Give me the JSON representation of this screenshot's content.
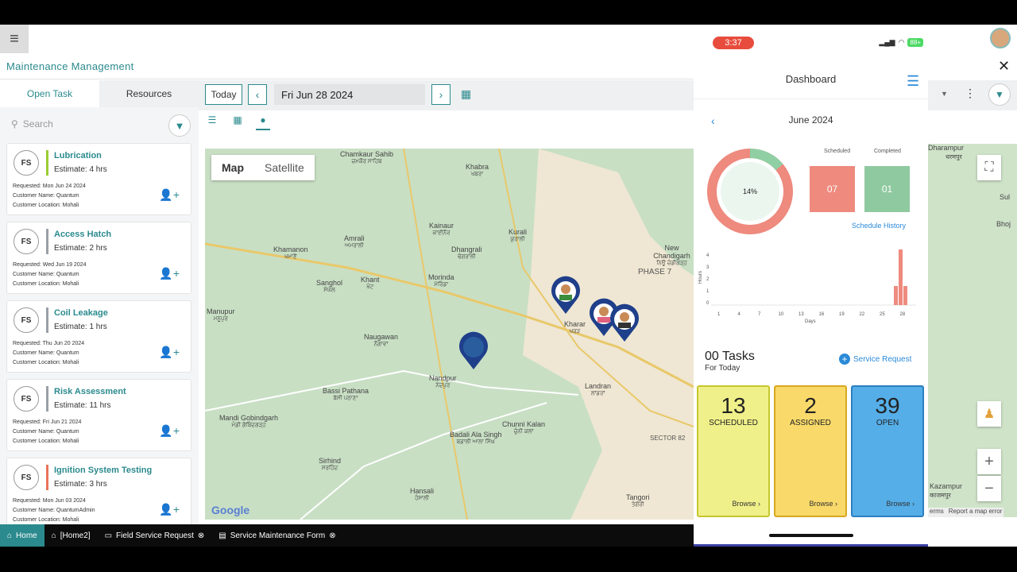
{
  "app": {
    "title": "Maintenance Management",
    "tabs": [
      "Open Task",
      "Resources"
    ],
    "search_placeholder": "Search"
  },
  "toolbar": {
    "today": "Today",
    "date": "Fri Jun 28 2024"
  },
  "map": {
    "type_map": "Map",
    "type_satellite": "Satellite",
    "google_logo": "Google",
    "places": [
      {
        "name": "Chamkaur Sahib",
        "sub": "ਚਮਕੌਰ ਸਾਹਿਬ"
      },
      {
        "name": "Khabra",
        "sub": "ਖਬਰਾ"
      },
      {
        "name": "Kainaur",
        "sub": "ਕਾਈਨੌਰ"
      },
      {
        "name": "Kurali",
        "sub": "ਕੁਰਾਲੀ"
      },
      {
        "name": "Amrali",
        "sub": "ਅਮਰਾਲੀ"
      },
      {
        "name": "Dhangrali",
        "sub": "ਢੰਗਰਾਲੀ"
      },
      {
        "name": "Khamanon",
        "sub": "ਖਮਾਣੋਂ"
      },
      {
        "name": "Sanghol",
        "sub": "ਸੰਘੋਲ"
      },
      {
        "name": "Khant",
        "sub": "ਖੰਟ"
      },
      {
        "name": "Morinda",
        "sub": "ਮੋਰਿੰਡਾ"
      },
      {
        "name": "New Chandigarh",
        "sub": "ਨਿਊ ਚੰਡੀਗੜ੍ਹ"
      },
      {
        "name": "Manupur",
        "sub": "ਮਨੂਪੁਰ"
      },
      {
        "name": "Kharar",
        "sub": "ਖਰੜ"
      },
      {
        "name": "Naugawan",
        "sub": "ਨੌਗਾਵਾਂ"
      },
      {
        "name": "Nandpur",
        "sub": "ਨੰਦਪੁਰ"
      },
      {
        "name": "Landran",
        "sub": "ਲਾਂਡਰਾਂ"
      },
      {
        "name": "Bassi Pathana",
        "sub": "ਬੱਸੀ ਪਠਾਣਾ"
      },
      {
        "name": "Mandi Gobindgarh",
        "sub": "ਮੰਡੀ ਗੋਬਿੰਦਗੜ੍ਹ"
      },
      {
        "name": "Chunni Kalan",
        "sub": "ਚੁੰਨੀ ਕਲਾਂ"
      },
      {
        "name": "Badali Ala Singh",
        "sub": "ਬਡਾਲੀ ਆਲਾ ਸਿੰਘ"
      },
      {
        "name": "Sirhind",
        "sub": "ਸਰਹਿੰਦ"
      },
      {
        "name": "Hansali",
        "sub": "ਹੰਸਾਲੀ"
      },
      {
        "name": "Tangori",
        "sub": "ਤੰਗੋਰੀ"
      }
    ],
    "sector": "SECTOR 82",
    "phase": "PHASE 7"
  },
  "tasks": [
    {
      "initials": "FS",
      "title": "Lubrication",
      "estimate": "Estimate: 4 hrs",
      "requested": "Requested: Mon Jun 24 2024",
      "customer": "Customer Name: Quantum",
      "location": "Customer Location: Mohali",
      "color": "#9acd32"
    },
    {
      "initials": "FS",
      "title": "Access Hatch",
      "estimate": "Estimate: 2 hrs",
      "requested": "Requested: Wed Jun 19 2024",
      "customer": "Customer Name: Quantum",
      "location": "Customer Location: Mohali",
      "color": "#9aa0a6"
    },
    {
      "initials": "FS",
      "title": "Coil Leakage",
      "estimate": "Estimate: 1 hrs",
      "requested": "Requested: Thu Jun 20 2024",
      "customer": "Customer Name: Quantum",
      "location": "Customer Location: Mohali",
      "color": "#9aa0a6"
    },
    {
      "initials": "FS",
      "title": "Risk Assessment",
      "estimate": "Estimate: 11 hrs",
      "requested": "Requested: Fri Jun 21 2024",
      "customer": "Customer Name: Quantum",
      "location": "Customer Location: Mohali",
      "color": "#9aa0a6"
    },
    {
      "initials": "FS",
      "title": "Ignition System Testing",
      "estimate": "Estimate: 3 hrs",
      "requested": "Requested: Mon Jun 03 2024",
      "customer": "Customer Name: QuantumAdmin",
      "location": "Customer Location: Mohali",
      "color": "#e8735a"
    }
  ],
  "bottom_nav": [
    "Home",
    "[Home2]",
    "Field Service Request",
    "Service Maintenance Form"
  ],
  "phone": {
    "time": "3:37",
    "battery": "88+",
    "title": "Dashboard",
    "month": "June 2024",
    "percent": "14%",
    "scheduled_label": "Scheduled",
    "completed_label": "Completed",
    "scheduled_count": "07",
    "completed_count": "01",
    "schedule_history": "Schedule History",
    "chart_y_label": "Hours",
    "chart_x_label": "Days",
    "chart_y_ticks": [
      "4",
      "3",
      "2",
      "1",
      "0"
    ],
    "chart_x_ticks": [
      "1",
      "4",
      "7",
      "10",
      "13",
      "16",
      "19",
      "22",
      "25",
      "28"
    ],
    "tasks_count": "00 Tasks",
    "tasks_sub": "For Today",
    "service_request": "Service Request",
    "tiles": [
      {
        "num": "13",
        "label": "SCHEDULED",
        "browse": "Browse",
        "bg": "#f0f08a",
        "border": "#c6c62e"
      },
      {
        "num": "2",
        "label": "ASSIGNED",
        "browse": "Browse",
        "bg": "#f8d96a",
        "border": "#d8a820"
      },
      {
        "num": "39",
        "label": "OPEN",
        "browse": "Browse",
        "bg": "#55aee8",
        "border": "#2b7fc0"
      }
    ]
  },
  "right_map": {
    "labels": [
      "Dharampur",
      "धरमपुर",
      "Sul",
      "Bhoj",
      "Kazampur",
      "काजमपुर"
    ],
    "footer": "Report a map error",
    "terms": "erms"
  },
  "colors": {
    "accent": "#2b8a8e",
    "phone_accent": "#2b8ad8",
    "donut_pink": "#ee8a7e",
    "donut_green": "#8fcfa3"
  }
}
